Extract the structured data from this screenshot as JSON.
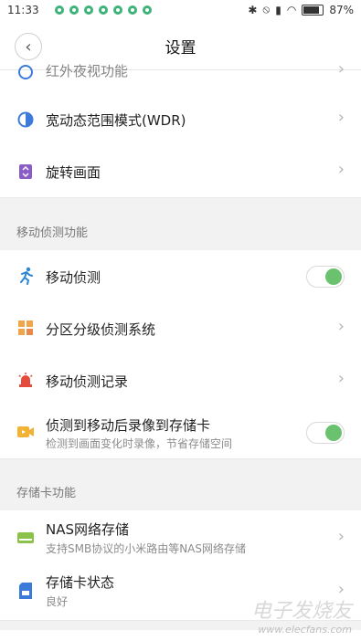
{
  "status_bar": {
    "time": "11:33",
    "battery": "87%"
  },
  "header": {
    "title": "设置"
  },
  "rows_top": [
    {
      "label": "红外夜视功能",
      "icon": "moon-icon"
    },
    {
      "label": "宽动态范围模式(WDR)",
      "icon": "half-circle-icon"
    },
    {
      "label": "旋转画面",
      "icon": "rotate-icon"
    }
  ],
  "section_motion": {
    "label": "移动侦测功能"
  },
  "motion": {
    "detect": {
      "label": "移动侦测",
      "enabled": true
    },
    "zone": {
      "label": "分区分级侦测系统"
    },
    "records": {
      "label": "移动侦测记录"
    },
    "record_sd": {
      "label": "侦测到移动后录像到存储卡",
      "sub": "检测到画面变化时录像，节省存储空间",
      "enabled": true
    }
  },
  "section_storage": {
    "label": "存储卡功能"
  },
  "storage": {
    "nas": {
      "label": "NAS网络存储",
      "sub": "支持SMB协议的小米路由等NAS网络存储"
    },
    "sd_status": {
      "label": "存储卡状态",
      "sub": "良好"
    }
  },
  "watermark": {
    "cn": "电子发烧友",
    "url": "www.elecfans.com"
  },
  "colors": {
    "toggle_on": "#6ac26f",
    "accent_blue": "#3c7bd9"
  }
}
